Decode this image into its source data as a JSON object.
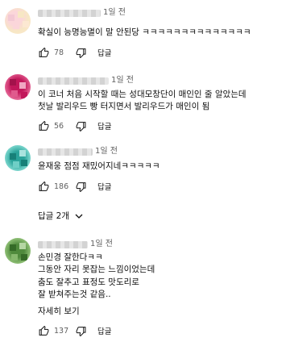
{
  "comments": [
    {
      "time": "1일 전",
      "lines": [
        "확실이 능명능멸이 말 안된당 ㅋㅋㅋㅋㅋㅋㅋㅋㅋㅋㅋㅋㅋㅋ"
      ],
      "likes": "78",
      "reply_label": "답글",
      "avatar_colors": [
        "#fbd6da",
        "#f7e7c4",
        "#fce8d2",
        "#f3c9d4"
      ]
    },
    {
      "time": "1일 전",
      "lines": [
        "이 코너 처음 시작할 때는 성대모창단이 매인인 줄 알았는데",
        "첫날 발리우드 빵 터지면서 발리우드가 매인이 됨"
      ],
      "likes": "56",
      "reply_label": "답글",
      "avatar_colors": [
        "#c2185b",
        "#e05a8d",
        "#a3124b",
        "#f0a6c2"
      ]
    },
    {
      "time": "1일 전",
      "lines": [
        "윤재웅 점점 재밌어지네ㅋㅋㅋㅋㅋ"
      ],
      "likes": "186",
      "reply_label": "답글",
      "avatar_colors": [
        "#2aa39a",
        "#6fcfc6",
        "#178078",
        "#a9e3de"
      ]
    },
    {
      "time": "1일 전",
      "lines": [
        "손민경 잘한다ㅋㅋ",
        "그동안 자리 못잡는 느낌이었는데",
        "춤도 잘추고 표정도 맛도리로",
        "잘 받쳐주는것 같음.."
      ],
      "read_more": "자세히 보기",
      "likes": "137",
      "reply_label": "답글",
      "avatar_colors": [
        "#4f8a3c",
        "#86b86d",
        "#356b27",
        "#b5d6a3"
      ]
    }
  ],
  "more_replies_label": "답글 2개"
}
